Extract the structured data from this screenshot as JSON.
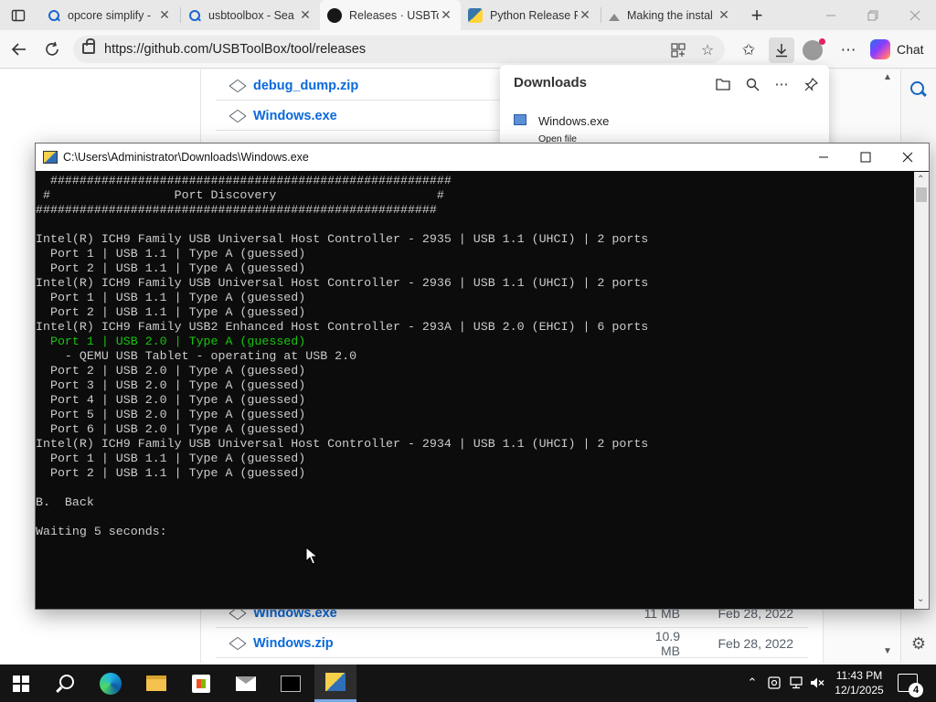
{
  "browser": {
    "tabs": [
      {
        "title": "opcore simplify -",
        "favicon": "search-icon"
      },
      {
        "title": "usbtoolbox - Sea",
        "favicon": "search-icon"
      },
      {
        "title": "Releases · USBToo",
        "favicon": "github-icon",
        "active": true
      },
      {
        "title": "Python Release P",
        "favicon": "python-icon"
      },
      {
        "title": "Making the instal",
        "favicon": "loading-icon"
      }
    ],
    "url": "https://github.com/USBToolBox/tool/releases",
    "copilot_label": "Chat"
  },
  "page": {
    "assets_top": [
      {
        "name": "debug_dump.zip"
      },
      {
        "name": "Windows.exe"
      }
    ],
    "assets_bottom": [
      {
        "name": "Windows.exe",
        "size": "11 MB",
        "date": "Feb 28, 2022"
      },
      {
        "name": "Windows.zip",
        "size": "10.9 MB",
        "date": "Feb 28, 2022"
      }
    ]
  },
  "downloads": {
    "title": "Downloads",
    "item_name": "Windows.exe",
    "item_action": "Open file"
  },
  "console": {
    "title": "C:\\Users\\Administrator\\Downloads\\Windows.exe",
    "lines": [
      {
        "text": "  #######################################################"
      },
      {
        "text": " #                 Port Discovery                      #"
      },
      {
        "text": "#######################################################"
      },
      {
        "text": ""
      },
      {
        "text": "Intel(R) ICH9 Family USB Universal Host Controller - 2935 | USB 1.1 (UHCI) | 2 ports"
      },
      {
        "text": "  Port 1 | USB 1.1 | Type A (guessed)"
      },
      {
        "text": "  Port 2 | USB 1.1 | Type A (guessed)"
      },
      {
        "text": "Intel(R) ICH9 Family USB Universal Host Controller - 2936 | USB 1.1 (UHCI) | 2 ports"
      },
      {
        "text": "  Port 1 | USB 1.1 | Type A (guessed)"
      },
      {
        "text": "  Port 2 | USB 1.1 | Type A (guessed)"
      },
      {
        "text": "Intel(R) ICH9 Family USB2 Enhanced Host Controller - 293A | USB 2.0 (EHCI) | 6 ports"
      },
      {
        "text": "  Port 1 | USB 2.0 | Type A (guessed)",
        "highlight": true
      },
      {
        "text": "    - QEMU USB Tablet - operating at USB 2.0"
      },
      {
        "text": "  Port 2 | USB 2.0 | Type A (guessed)"
      },
      {
        "text": "  Port 3 | USB 2.0 | Type A (guessed)"
      },
      {
        "text": "  Port 4 | USB 2.0 | Type A (guessed)"
      },
      {
        "text": "  Port 5 | USB 2.0 | Type A (guessed)"
      },
      {
        "text": "  Port 6 | USB 2.0 | Type A (guessed)"
      },
      {
        "text": "Intel(R) ICH9 Family USB Universal Host Controller - 2934 | USB 1.1 (UHCI) | 2 ports"
      },
      {
        "text": "  Port 1 | USB 1.1 | Type A (guessed)"
      },
      {
        "text": "  Port 2 | USB 1.1 | Type A (guessed)"
      },
      {
        "text": ""
      },
      {
        "text": "B.  Back"
      },
      {
        "text": ""
      },
      {
        "text": "Waiting 5 seconds:"
      }
    ]
  },
  "taskbar": {
    "time": "11:43 PM",
    "date": "12/1/2025",
    "notification_count": "4"
  },
  "colors": {
    "console_bg": "#0c0c0c",
    "console_text": "#cccccc",
    "console_highlight": "#16c60c",
    "link": "#0969da"
  }
}
